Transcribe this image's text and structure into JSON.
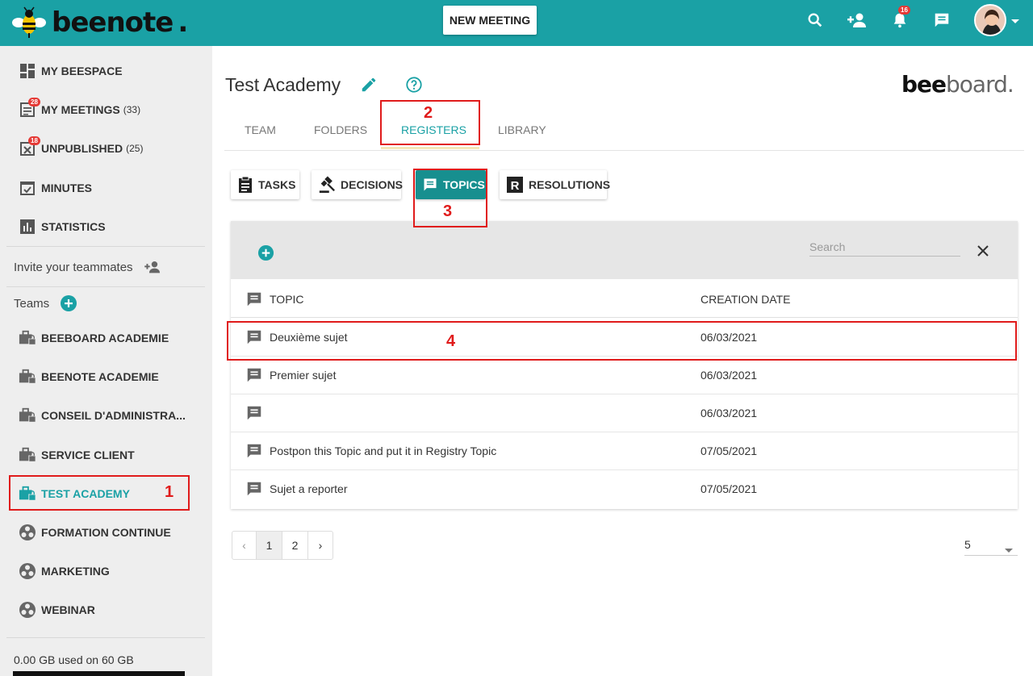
{
  "header": {
    "logo_text": "beenote",
    "new_meeting_label": "NEW MEETING",
    "notifications_count": "16",
    "icons": [
      "search-icon",
      "add-user-icon",
      "bell-icon",
      "chat-icon"
    ]
  },
  "sidebar": {
    "items": [
      {
        "label": "MY BEESPACE",
        "icon": "dashboard-icon"
      },
      {
        "label": "MY MEETINGS",
        "count": "(33)",
        "badge": "28",
        "icon": "meetings-icon"
      },
      {
        "label": "UNPUBLISHED",
        "count": "(25)",
        "badge": "18",
        "icon": "unpublished-icon"
      },
      {
        "label": "MINUTES",
        "icon": "minutes-icon"
      },
      {
        "label": "STATISTICS",
        "icon": "statistics-icon"
      }
    ],
    "invite_label": "Invite your teammates",
    "teams_label": "Teams",
    "teams": [
      {
        "label": "BEEBOARD ACADEMIE",
        "icon": "locked-briefcase-icon"
      },
      {
        "label": "BEENOTE ACADEMIE",
        "icon": "locked-briefcase-icon"
      },
      {
        "label": "CONSEIL D'ADMINISTRA...",
        "icon": "locked-briefcase-icon"
      },
      {
        "label": "SERVICE CLIENT",
        "icon": "locked-briefcase-icon"
      },
      {
        "label": "TEST ACADEMY",
        "icon": "locked-briefcase-icon",
        "active": true
      },
      {
        "label": "FORMATION CONTINUE",
        "icon": "team-circle-icon"
      },
      {
        "label": "MARKETING",
        "icon": "team-circle-icon"
      },
      {
        "label": "WEBINAR",
        "icon": "team-circle-icon"
      }
    ],
    "storage_label": "0.00 GB used on 60 GB"
  },
  "main": {
    "title": "Test Academy",
    "brand": {
      "part1": "bee",
      "part2": "board."
    },
    "tabs": [
      {
        "label": "TEAM"
      },
      {
        "label": "FOLDERS"
      },
      {
        "label": "REGISTERS",
        "active": true
      },
      {
        "label": "LIBRARY"
      }
    ],
    "registers": [
      {
        "label": "TASKS"
      },
      {
        "label": "DECISIONS"
      },
      {
        "label": "TOPICS",
        "active": true
      },
      {
        "label": "RESOLUTIONS"
      }
    ],
    "search_placeholder": "Search",
    "columns": {
      "topic": "TOPIC",
      "date": "CREATION DATE"
    },
    "rows": [
      {
        "topic": "Deuxième sujet",
        "date": "06/03/2021"
      },
      {
        "topic": "Premier sujet",
        "date": "06/03/2021"
      },
      {
        "topic": "",
        "date": "06/03/2021"
      },
      {
        "topic": "Postpon this Topic and put it in Registry Topic",
        "date": "07/05/2021"
      },
      {
        "topic": "Sujet a reporter",
        "date": "07/05/2021"
      }
    ],
    "pagination": {
      "prev": "‹",
      "pages": [
        "1",
        "2"
      ],
      "next": "›",
      "page_size": "5"
    }
  },
  "annotations": [
    "1",
    "2",
    "3",
    "4"
  ],
  "colors": {
    "teal": "#1aa1a5",
    "annotation_red": "#e01b1b"
  }
}
